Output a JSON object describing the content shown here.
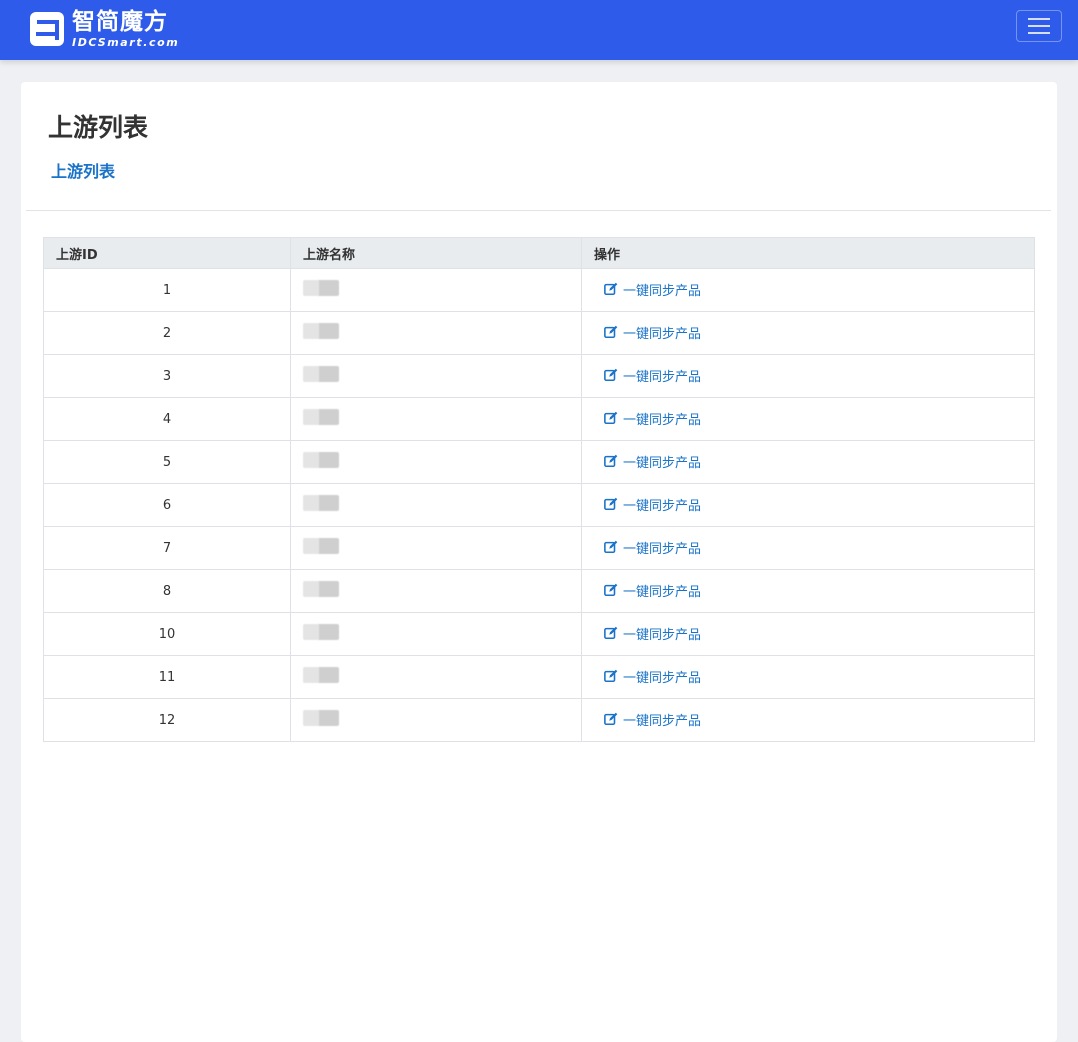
{
  "brand": {
    "name_cn": "智简魔方",
    "name_en": "IDCSmart.com"
  },
  "page": {
    "title": "上游列表",
    "breadcrumb": "上游列表"
  },
  "table": {
    "headers": [
      "上游ID",
      "上游名称",
      "操作"
    ],
    "action_label": "一键同步产品",
    "rows": [
      {
        "id": "1"
      },
      {
        "id": "2"
      },
      {
        "id": "3"
      },
      {
        "id": "4"
      },
      {
        "id": "5"
      },
      {
        "id": "6"
      },
      {
        "id": "7"
      },
      {
        "id": "8"
      },
      {
        "id": "10"
      },
      {
        "id": "11"
      },
      {
        "id": "12"
      }
    ]
  },
  "colors": {
    "header_bg": "#2f5bea",
    "link": "#1a73c8"
  },
  "icons": {
    "menu": "hamburger-icon",
    "action": "edit-icon"
  }
}
